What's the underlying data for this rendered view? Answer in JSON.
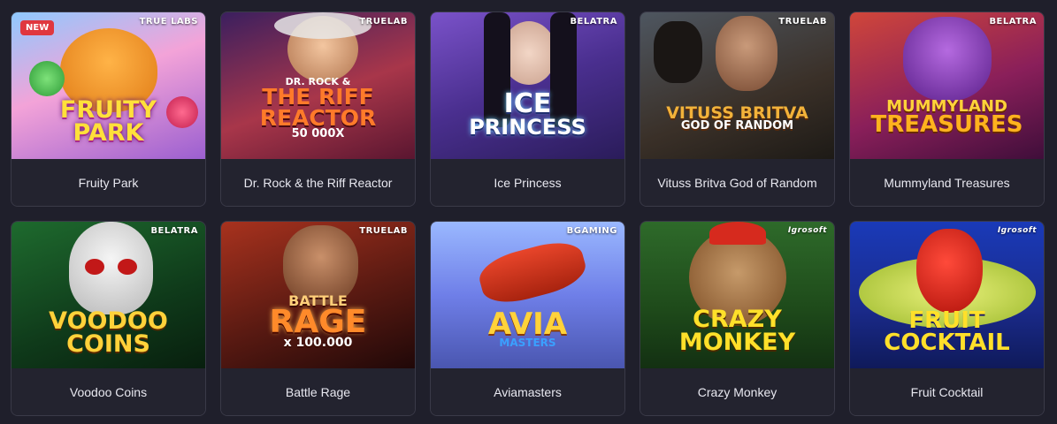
{
  "colors": {
    "page_bg": "#1f1f2b",
    "card_bg": "#23232f",
    "card_border": "#3a3a48",
    "caption_text": "#e8e8f0",
    "new_badge": "#e0373f"
  },
  "games": [
    {
      "title": "Fruity Park",
      "provider": "TRUE LABS",
      "badge": "NEW",
      "logo_lines": [
        "FRUITY",
        "PARK"
      ]
    },
    {
      "title": "Dr. Rock & the Riff Reactor",
      "provider": "TRUELAB",
      "logo_lines": [
        "DR. ROCK &",
        "THE RIFF",
        "REACTOR",
        "50 000X"
      ]
    },
    {
      "title": "Ice Princess",
      "provider": "BELATRA",
      "logo_lines": [
        "ICE",
        "PRINCESS"
      ]
    },
    {
      "title": "Vituss Britva God of Random",
      "provider": "TRUELAB",
      "logo_lines": [
        "VITUSS BRITVA",
        "GOD OF RANDOM"
      ]
    },
    {
      "title": "Mummyland Treasures",
      "provider": "BELATRA",
      "logo_lines": [
        "MUMMYLAND",
        "TREASURES"
      ]
    },
    {
      "title": "Voodoo Coins",
      "provider": "BELATRA",
      "logo_lines": [
        "VOODOO",
        "COINS"
      ]
    },
    {
      "title": "Battle Rage",
      "provider": "TRUELAB",
      "logo_lines": [
        "BATTLE",
        "RAGE",
        "x 100.000"
      ]
    },
    {
      "title": "Aviamasters",
      "provider": "BGAMING",
      "logo_lines": [
        "AVIA",
        "MASTERS"
      ]
    },
    {
      "title": "Crazy Monkey",
      "provider": "Igrosoft",
      "logo_lines": [
        "CRAZY",
        "MONKEY"
      ]
    },
    {
      "title": "Fruit Cocktail",
      "provider": "Igrosoft",
      "logo_lines": [
        "FRUIT",
        "COCKTAIL"
      ]
    }
  ]
}
